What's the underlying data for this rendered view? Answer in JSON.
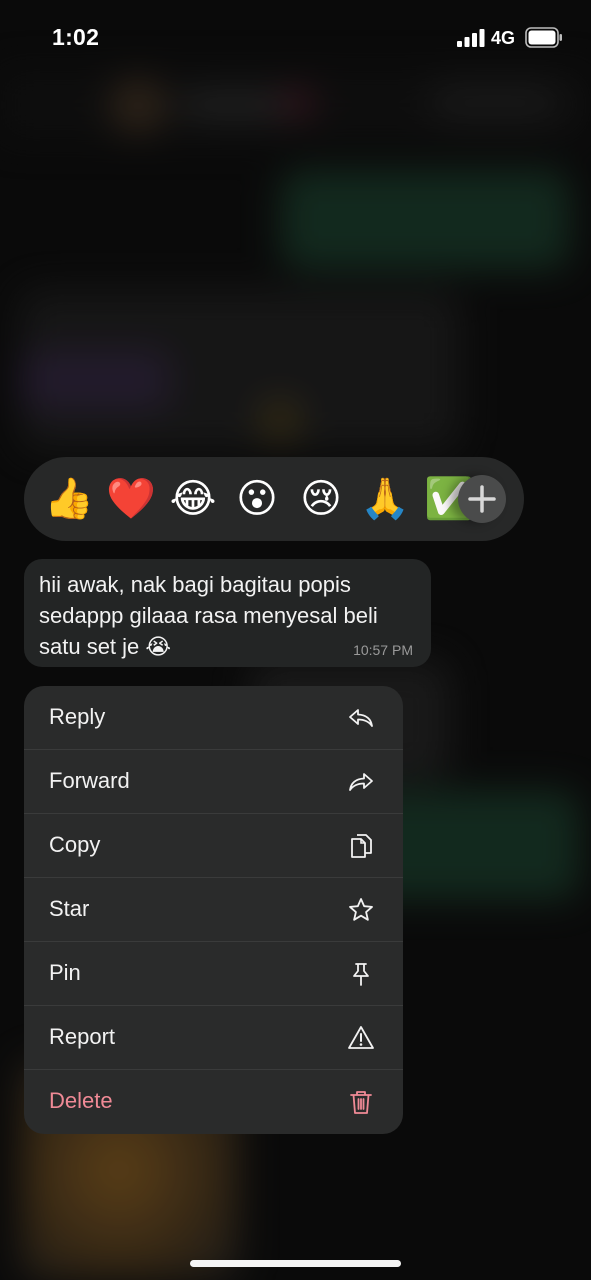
{
  "status_bar": {
    "time": "1:02",
    "network": "4G",
    "signal_icon": "cellular-signal-icon",
    "battery_icon": "battery-icon"
  },
  "reactions": {
    "items": [
      {
        "emoji": "👍",
        "name": "thumbs-up"
      },
      {
        "emoji": "❤️",
        "name": "red-heart"
      },
      {
        "emoji": "😂",
        "name": "tears-of-joy"
      },
      {
        "emoji": "😮",
        "name": "open-mouth"
      },
      {
        "emoji": "😢",
        "name": "crying-face"
      },
      {
        "emoji": "🙏",
        "name": "folded-hands"
      },
      {
        "emoji": "✅",
        "name": "check-mark"
      }
    ],
    "add_icon": "plus-icon"
  },
  "message": {
    "text": "hii awak, nak bagi bagitau popis sedappp gilaaa rasa menyesal beli satu set je 😭",
    "time": "10:57 PM"
  },
  "menu": {
    "items": [
      {
        "label": "Reply",
        "icon": "reply-icon"
      },
      {
        "label": "Forward",
        "icon": "forward-icon"
      },
      {
        "label": "Copy",
        "icon": "copy-icon"
      },
      {
        "label": "Star",
        "icon": "star-icon"
      },
      {
        "label": "Pin",
        "icon": "pin-icon"
      },
      {
        "label": "Report",
        "icon": "warning-icon"
      },
      {
        "label": "Delete",
        "icon": "trash-icon"
      }
    ]
  },
  "colors": {
    "menu_background": "#2a2b2b",
    "bubble_background": "#232525",
    "delete_accent": "#f08a96",
    "text_primary": "#f2f2f2",
    "timestamp": "#9a9a9a"
  }
}
